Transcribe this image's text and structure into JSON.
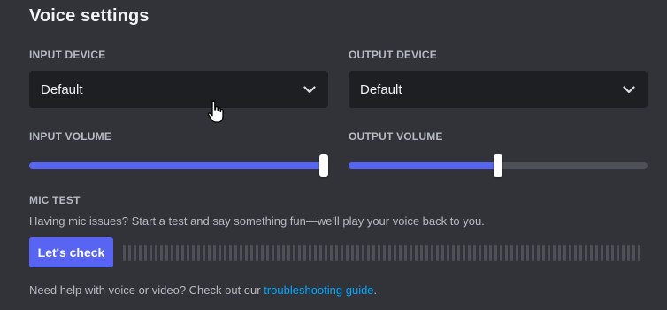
{
  "page": {
    "title": "Voice settings"
  },
  "input_device": {
    "label": "INPUT DEVICE",
    "value": "Default"
  },
  "output_device": {
    "label": "OUTPUT DEVICE",
    "value": "Default"
  },
  "input_volume": {
    "label": "INPUT VOLUME",
    "level_percent": 100
  },
  "output_volume": {
    "label": "OUTPUT VOLUME",
    "level_percent": 50
  },
  "mic_test": {
    "label": "MIC TEST",
    "description": "Having mic issues? Start a test and say something fun—we'll play your voice back to you.",
    "button_label": "Let's check",
    "meter_level_percent": 0
  },
  "footer": {
    "help_text": "Need help with voice or video? Check out our ",
    "link_text": "troubleshooting guide",
    "help_suffix": "."
  },
  "colors": {
    "background": "#313338",
    "accent": "#5865f2",
    "link": "#00a8fc"
  },
  "icons": {
    "dropdown": "chevron-down-icon",
    "cursor": "hand-pointer-icon"
  }
}
